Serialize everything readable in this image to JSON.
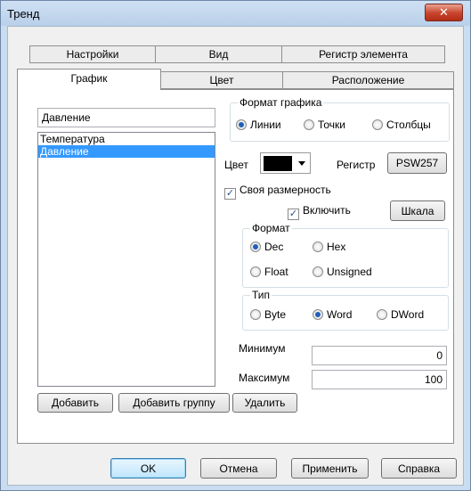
{
  "window": {
    "title": "Тренд",
    "close_glyph": "✕"
  },
  "tabs": {
    "row_back": [
      "Настройки",
      "Вид",
      "Регистр элемента"
    ],
    "row_front": [
      "График",
      "Цвет",
      "Расположение"
    ],
    "active": "График"
  },
  "left": {
    "name_value": "Давление",
    "list_items": [
      "Температура",
      "Давление"
    ],
    "selected_item": "Давление",
    "buttons": {
      "add": "Добавить",
      "add_group": "Добавить группу",
      "remove": "Удалить"
    }
  },
  "format_graph": {
    "label": "Формат графика",
    "options": [
      "Линии",
      "Точки",
      "Столбцы"
    ],
    "selected": "Линии"
  },
  "color": {
    "label": "Цвет",
    "value_color": "#000000"
  },
  "register": {
    "label": "Регистр",
    "button": "PSW257"
  },
  "own_dimension": {
    "label": "Своя размерность",
    "checked": true
  },
  "enable": {
    "label": "Включить",
    "checked": true
  },
  "scale_button": "Шкала",
  "format": {
    "label": "Формат",
    "options": [
      "Dec",
      "Hex",
      "Float",
      "Unsigned"
    ],
    "selected": "Dec"
  },
  "type": {
    "label": "Тип",
    "options": [
      "Byte",
      "Word",
      "DWord"
    ],
    "selected": "Word"
  },
  "minimum": {
    "label": "Минимум",
    "value": "0"
  },
  "maximum": {
    "label": "Максимум",
    "value": "100"
  },
  "footer": {
    "ok": "OK",
    "cancel": "Отмена",
    "apply": "Применить",
    "help": "Справка"
  }
}
